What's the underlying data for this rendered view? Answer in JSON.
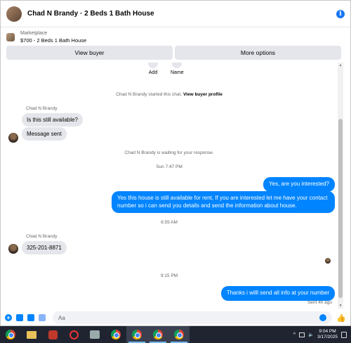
{
  "header": {
    "title": "Chad N Brandy · 2 Beds 1 Bath House",
    "info_icon": "info-icon"
  },
  "listing": {
    "category": "Marketplace",
    "name": "$700 - 2 Beds 1 Bath House"
  },
  "actions": {
    "view_buyer": "View buyer",
    "more_options": "More options"
  },
  "top_actions": [
    {
      "label": "Add"
    },
    {
      "label": "Name"
    }
  ],
  "conversation": {
    "started_prefix": "Chad N Brandy started this chat.",
    "started_link": "View buyer profile",
    "sender_name_1": "Chad N Brandy",
    "msg_in_1": "Is this still available?",
    "msg_in_2": "Message sent",
    "waiting": "Chad N Brandy is waiting for your response.",
    "time_1": "Sun 7:47 PM",
    "msg_out_1": "Yes, are you interested?",
    "msg_out_2": "Yes this house is still available for rent,  If you are interested  let me have your contact number so i can send you details and send the information about house.",
    "time_2": "6:55 AM",
    "sender_name_2": "Chad N Brandy",
    "msg_in_3": "325-201-8871",
    "time_3": "9:15 PM",
    "msg_out_3": "Thanks i willl send all info at your number",
    "sent_status": "Sent 4h ago"
  },
  "composer": {
    "placeholder": "Aa"
  },
  "taskbar": {
    "apps": [
      "chrome",
      "file-explorer",
      "app-red",
      "app-red-circle",
      "app-gray",
      "chrome",
      "chrome",
      "chrome",
      "chrome"
    ],
    "time": "9:04 PM",
    "date": "3/17/2025"
  },
  "colors": {
    "accent": "#0084ff",
    "bubble_in": "#e4e6eb",
    "taskbar": "#1f2430"
  }
}
